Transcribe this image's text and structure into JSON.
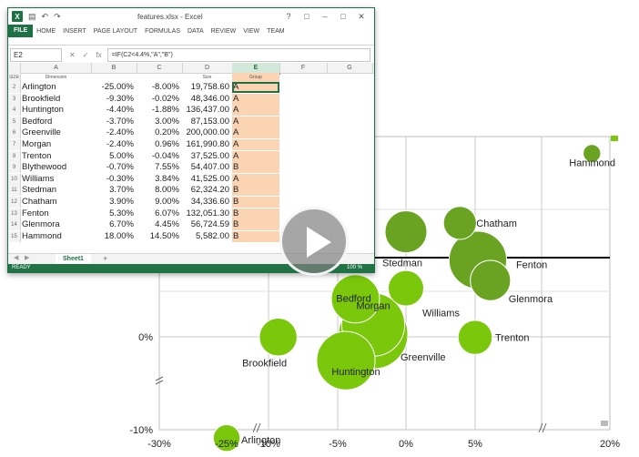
{
  "chart_data": {
    "type": "bubble",
    "x_ticks": [
      "-30%",
      "-25%",
      "-10%",
      "-5%",
      "0%",
      "5%",
      "20%"
    ],
    "y_ticks": [
      "0%",
      "-10%"
    ],
    "points": [
      {
        "name": "Hammond",
        "x": 18.0,
        "y": 14.5,
        "size": 5582
      },
      {
        "name": "Chatham",
        "x": 3.9,
        "y": 9.0,
        "size": 34337
      },
      {
        "name": "Stedman",
        "x": 0.0,
        "y": 8.3,
        "size": 62324
      },
      {
        "name": "Fenton",
        "x": 5.3,
        "y": 6.07,
        "size": 132051
      },
      {
        "name": "Glenmora",
        "x": 6.7,
        "y": 4.45,
        "size": 56725
      },
      {
        "name": "Williams",
        "x": 0.0,
        "y": 3.84,
        "size": 41525
      },
      {
        "name": "Bedford",
        "x": -3.7,
        "y": 3.0,
        "size": 87153
      },
      {
        "name": "Morgan",
        "x": -2.4,
        "y": 0.96,
        "size": 161991
      },
      {
        "name": "Greenville",
        "x": -2.4,
        "y": 0.2,
        "size": 200000
      },
      {
        "name": "Brookfield",
        "x": -9.3,
        "y": -0.02,
        "size": 48346
      },
      {
        "name": "Trenton",
        "x": 5.0,
        "y": -0.04,
        "size": 37525
      },
      {
        "name": "Huntington",
        "x": -4.4,
        "y": -1.88,
        "size": 136437
      },
      {
        "name": "Arlington",
        "x": -25.0,
        "y": -8.0,
        "size": 19759
      }
    ],
    "colors": {
      "group_a": "#7ac70c",
      "group_b": "#6aa321"
    }
  },
  "excel": {
    "logo": "X",
    "title": "features.xlsx - Excel",
    "tabs": [
      "FILE",
      "HOME",
      "INSERT",
      "PAGE LAYOUT",
      "FORMULAS",
      "DATA",
      "REVIEW",
      "VIEW",
      "TEAM"
    ],
    "name_box": "E2",
    "fx": "fx",
    "formula": "=IF(C2<4.4%,\"A\",\"B\")",
    "columns": [
      "A",
      "B",
      "C",
      "D",
      "E",
      "F",
      "G"
    ],
    "header_labels": {
      "a": "Dimension",
      "d": "Size",
      "e": "Group"
    },
    "header_row_label": "size",
    "rows": [
      {
        "n": "2",
        "name": "Arlington",
        "b": "-25.00%",
        "c": "-8.00%",
        "d": "19,758.60",
        "e": "A"
      },
      {
        "n": "3",
        "name": "Brookfield",
        "b": "-9.30%",
        "c": "-0.02%",
        "d": "48,346.00",
        "e": "A"
      },
      {
        "n": "4",
        "name": "Huntington",
        "b": "-4.40%",
        "c": "-1.88%",
        "d": "136,437.00",
        "e": "A"
      },
      {
        "n": "5",
        "name": "Bedford",
        "b": "-3.70%",
        "c": "3.00%",
        "d": "87,153.00",
        "e": "A"
      },
      {
        "n": "6",
        "name": "Greenville",
        "b": "-2.40%",
        "c": "0.20%",
        "d": "200,000.00",
        "e": "A"
      },
      {
        "n": "7",
        "name": "Morgan",
        "b": "-2.40%",
        "c": "0.96%",
        "d": "161,990.80",
        "e": "A"
      },
      {
        "n": "8",
        "name": "Trenton",
        "b": "5.00%",
        "c": "-0.04%",
        "d": "37,525.00",
        "e": "A"
      },
      {
        "n": "9",
        "name": "Blythewood",
        "b": "-0.70%",
        "c": "7.55%",
        "d": "54,407.00",
        "e": "B"
      },
      {
        "n": "10",
        "name": "Williams",
        "b": "-0.30%",
        "c": "3.84%",
        "d": "41,525.00",
        "e": "A"
      },
      {
        "n": "11",
        "name": "Stedman",
        "b": "3.70%",
        "c": "8.00%",
        "d": "62,324.20",
        "e": "B"
      },
      {
        "n": "12",
        "name": "Chatham",
        "b": "3.90%",
        "c": "9.00%",
        "d": "34,336.60",
        "e": "B"
      },
      {
        "n": "13",
        "name": "Fenton",
        "b": "5.30%",
        "c": "6.07%",
        "d": "132,051.30",
        "e": "B"
      },
      {
        "n": "14",
        "name": "Glenmora",
        "b": "6.70%",
        "c": "4.45%",
        "d": "56,724.59",
        "e": "B"
      },
      {
        "n": "15",
        "name": "Hammond",
        "b": "18.00%",
        "c": "14.50%",
        "d": "5,582.00",
        "e": "B"
      }
    ],
    "sheet_tab": "Sheet1",
    "add_sheet": "+",
    "status": "READY",
    "zoom": "100 %"
  }
}
